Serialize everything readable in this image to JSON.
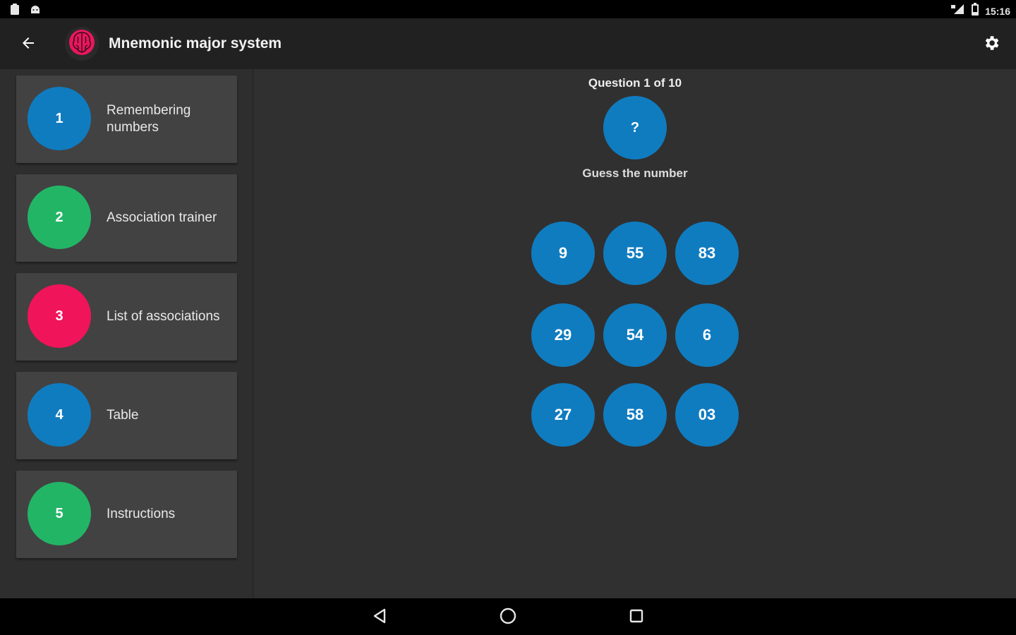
{
  "status_bar": {
    "time": "15:16",
    "left_icons": [
      "clipboard-icon",
      "android-icon"
    ],
    "right_icons": [
      "signal-icon",
      "battery-icon"
    ]
  },
  "app_bar": {
    "title": "Mnemonic major system",
    "logo_icon": "brain-icon",
    "back_icon": "arrow-back-icon",
    "settings_icon": "gear-icon"
  },
  "sidebar": {
    "items": [
      {
        "number": "1",
        "label": "Remembering numbers",
        "color": "#0f7cc0"
      },
      {
        "number": "2",
        "label": "Association trainer",
        "color": "#23b566"
      },
      {
        "number": "3",
        "label": "List of associations",
        "color": "#f0145a"
      },
      {
        "number": "4",
        "label": "Table",
        "color": "#0f7cc0"
      },
      {
        "number": "5",
        "label": "Instructions",
        "color": "#23b566"
      }
    ]
  },
  "quiz": {
    "question_label": "Question 1 of 10",
    "question_symbol": "?",
    "prompt": "Guess the number",
    "answers": [
      "9",
      "55",
      "83",
      "29",
      "54",
      "6",
      "27",
      "58",
      "03"
    ],
    "answer_color": "#0f7cc0"
  },
  "nav_bar": {
    "icons": [
      "nav-back-icon",
      "nav-home-icon",
      "nav-recents-icon"
    ]
  }
}
